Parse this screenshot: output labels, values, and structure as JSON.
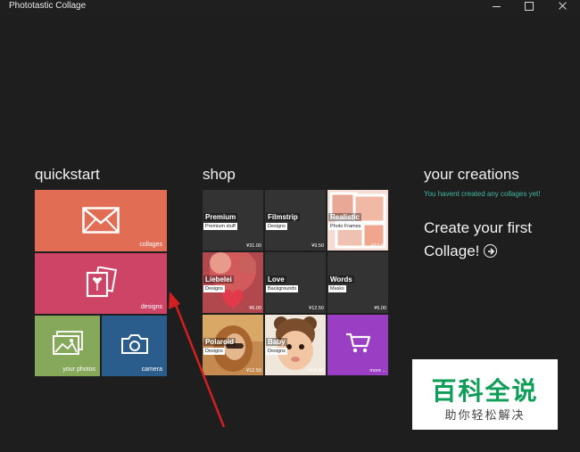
{
  "window": {
    "title": "Phototastic Collage"
  },
  "quickstart": {
    "title": "quickstart",
    "tiles": [
      {
        "label": "collages",
        "color": "#e26d55"
      },
      {
        "label": "designs",
        "color": "#cd4466"
      },
      {
        "label": "your photos",
        "color": "#86a85b"
      },
      {
        "label": "camera",
        "color": "#2a5d8b"
      }
    ]
  },
  "shop": {
    "title": "shop",
    "tiles": [
      {
        "name": "Premium",
        "sub": "Premium stuff",
        "price": "¥31.00"
      },
      {
        "name": "Filmstrip",
        "sub": "Designs",
        "price": "¥9.50"
      },
      {
        "name": "Realistic",
        "sub": "Photo Frames",
        "price": "¥12.50"
      },
      {
        "name": "Liebelei",
        "sub": "Designs",
        "price": "¥6.00"
      },
      {
        "name": "Love",
        "sub": "Backgrounds",
        "price": "¥12.50"
      },
      {
        "name": "Words",
        "sub": "Masks",
        "price": "¥6.00"
      },
      {
        "name": "Polaroid",
        "sub": "Designs",
        "price": "¥12.50"
      },
      {
        "name": "Baby",
        "sub": "Designs",
        "price": "¥18.50"
      },
      {
        "name": "",
        "sub": "",
        "price": "more ..."
      }
    ]
  },
  "creations": {
    "title": "your creations",
    "empty_note": "You havent created any collages yet!",
    "cta_line1": "Create your first",
    "cta_line2": "Collage!"
  },
  "watermark": {
    "title": "百科全说",
    "subtitle": "助你轻松解决"
  },
  "colors": {
    "background": "#1e1e1e",
    "accent_green": "#3fb89f",
    "shop_tile": "#333333",
    "more_tile": "#9a3fc4",
    "arrow": "#d21f1f"
  }
}
